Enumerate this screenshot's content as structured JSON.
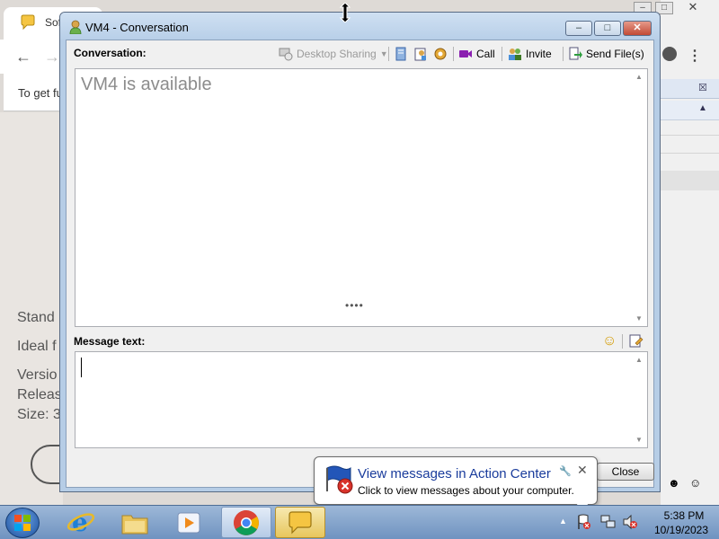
{
  "browser": {
    "tab_title": "Sof",
    "infobar_text": "To get fu",
    "page_lines": [
      "Stand",
      "Ideal f",
      "Versio",
      "Releas",
      "Size: 3"
    ]
  },
  "conversation": {
    "title": "VM4 - Conversation",
    "conversation_label": "Conversation:",
    "toolbar": {
      "desktop_sharing": "Desktop Sharing",
      "call": "Call",
      "invite": "Invite",
      "send_files": "Send File(s)"
    },
    "status_message": "VM4 is available",
    "message_label": "Message text:",
    "message_value": "",
    "close_button": "Close"
  },
  "balloon": {
    "title": "View messages in Action Center",
    "text": "Click to view messages about your computer."
  },
  "taskbar": {
    "time": "5:38 PM",
    "date": "10/19/2023"
  }
}
